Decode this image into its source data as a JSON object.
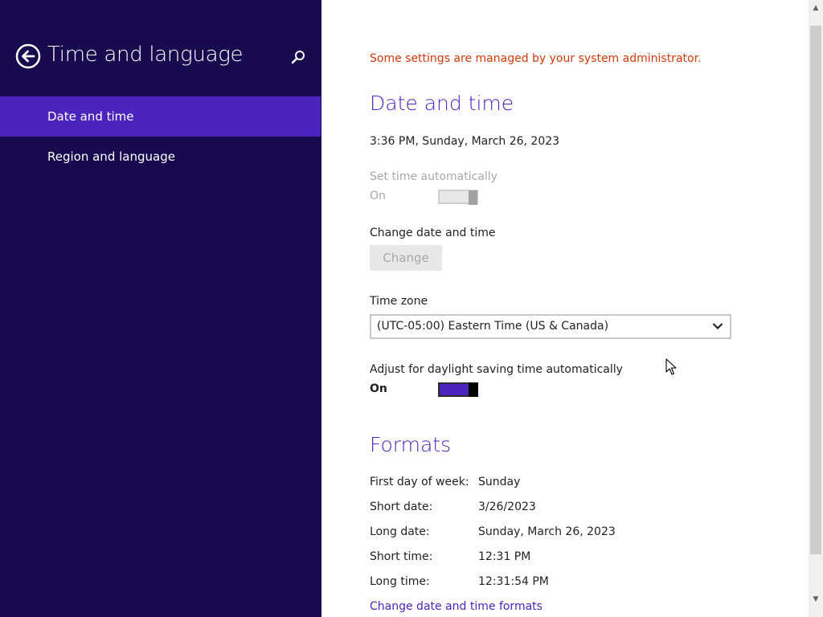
{
  "sidebar": {
    "title": "Time and language",
    "back_icon": "back-arrow-icon",
    "search_icon": "search-icon",
    "items": [
      {
        "label": "Date and time",
        "active": true
      },
      {
        "label": "Region and language",
        "active": false
      }
    ]
  },
  "main": {
    "admin_message": "Some settings are managed by your system administrator.",
    "date_time_heading": "Date and time",
    "current_datetime": "3:36 PM, Sunday, March 26, 2023",
    "set_time_auto": {
      "label": "Set time automatically",
      "state": "On",
      "enabled": false
    },
    "change_date_time": {
      "label": "Change date and time",
      "button": "Change",
      "enabled": false
    },
    "time_zone": {
      "label": "Time zone",
      "value": "(UTC-05:00) Eastern Time (US & Canada)"
    },
    "daylight_saving": {
      "label": "Adjust for daylight saving time automatically",
      "state": "On",
      "enabled": true
    },
    "formats_heading": "Formats",
    "formats": [
      {
        "label": "First day of week:",
        "value": "Sunday"
      },
      {
        "label": "Short date:",
        "value": "3/26/2023"
      },
      {
        "label": "Long date:",
        "value": "Sunday, March 26, 2023"
      },
      {
        "label": "Short time:",
        "value": "12:31 PM"
      },
      {
        "label": "Long time:",
        "value": "12:31:54 PM"
      }
    ],
    "change_formats_link": "Change date and time formats"
  },
  "colors": {
    "sidebar_bg": "#180a4f",
    "accent": "#4b24be",
    "warning": "#d33a0b"
  }
}
